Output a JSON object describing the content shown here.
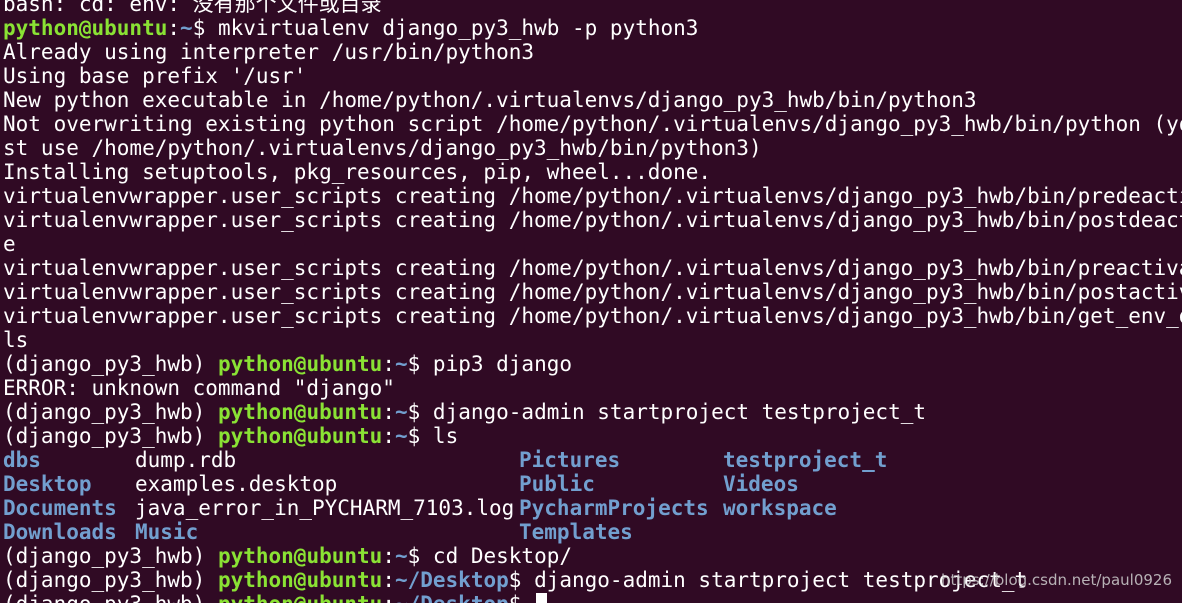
{
  "colors": {
    "background": "#300a24",
    "text": "#ffffff",
    "user_host": "#8ae234",
    "path": "#729fcf",
    "directory": "#729fcf"
  },
  "prompt": {
    "env": "(django_py3_hwb) ",
    "user_host": "python@ubuntu",
    "sep": ":",
    "home": "~",
    "desktop": "~/Desktop",
    "symbol": "$ "
  },
  "lines": {
    "l0": "bash: cd: env: 没有那个文件或目录",
    "l1_cmd": "mkvirtualenv django_py3_hwb -p python3",
    "l2": "Already using interpreter /usr/bin/python3",
    "l3": "Using base prefix '/usr'",
    "l4": "New python executable in /home/python/.virtualenvs/django_py3_hwb/bin/python3",
    "l5": "Not overwriting existing python script /home/python/.virtualenvs/django_py3_hwb/bin/python (you mu",
    "l6": "st use /home/python/.virtualenvs/django_py3_hwb/bin/python3)",
    "l7": "Installing setuptools, pkg_resources, pip, wheel...done.",
    "l8": "virtualenvwrapper.user_scripts creating /home/python/.virtualenvs/django_py3_hwb/bin/predeactivate",
    "l9": "virtualenvwrapper.user_scripts creating /home/python/.virtualenvs/django_py3_hwb/bin/postdeactivat",
    "l10": "e",
    "l11": "virtualenvwrapper.user_scripts creating /home/python/.virtualenvs/django_py3_hwb/bin/preactivate",
    "l12": "virtualenvwrapper.user_scripts creating /home/python/.virtualenvs/django_py3_hwb/bin/postactivate",
    "l13": "virtualenvwrapper.user_scripts creating /home/python/.virtualenvs/django_py3_hwb/bin/get_env_detai",
    "l14": "ls",
    "l15_cmd": "pip3 django",
    "l16": "ERROR: unknown command \"django\"",
    "l17_cmd": "django-admin startproject testproject_t",
    "l18_cmd": "ls",
    "l23_cmd": "cd Desktop/",
    "l24_cmd": "django-admin startproject testproject_t"
  },
  "ls": {
    "row1": [
      "dbs",
      "dump.rdb",
      "Pictures",
      "testproject_t"
    ],
    "row2": [
      "Desktop",
      "examples.desktop",
      "Public",
      "Videos"
    ],
    "row3": [
      "Documents",
      "java_error_in_PYCHARM_7103.log",
      "PycharmProjects",
      "workspace"
    ],
    "row4": [
      "Downloads",
      "Music",
      "Templates",
      ""
    ]
  },
  "watermark": "https://blog.csdn.net/paul0926"
}
